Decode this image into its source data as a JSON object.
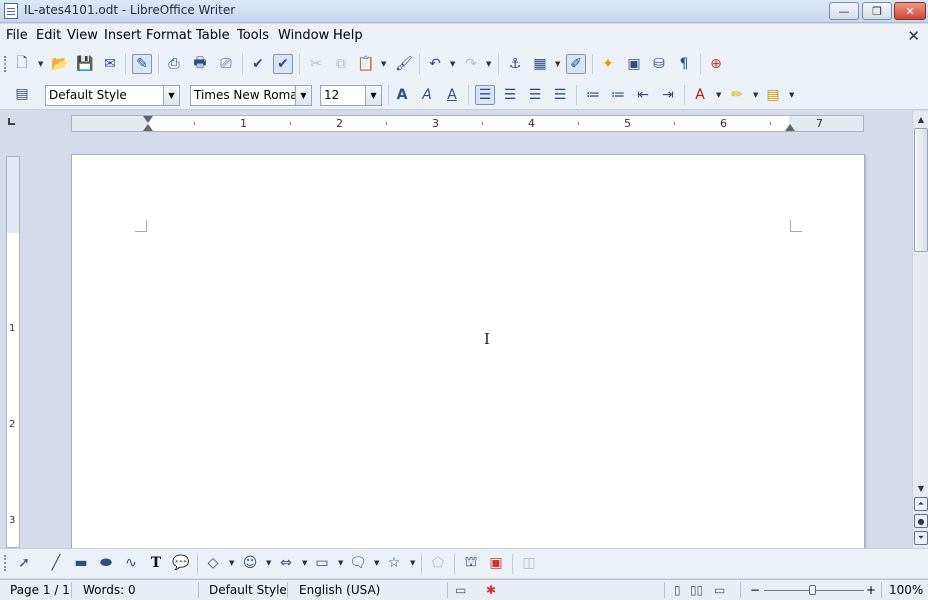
{
  "window": {
    "title": "IL-ates4101.odt - LibreOffice Writer",
    "minimize_label": "—",
    "maximize_label": "❐",
    "close_label": "✕"
  },
  "menu": {
    "items": [
      "File",
      "Edit",
      "View",
      "Insert",
      "Format",
      "Table",
      "Tools",
      "Window",
      "Help"
    ],
    "close_doc_label": "✕"
  },
  "formatting": {
    "paragraph_style": "Default Style",
    "font_name": "Times New Roman",
    "font_size": "12",
    "dropdown_arrow": "▼"
  },
  "ruler": {
    "labels": [
      "1",
      "2",
      "3",
      "4",
      "5",
      "6",
      "7"
    ],
    "vertical_labels": [
      "1",
      "2",
      "3"
    ]
  },
  "status": {
    "page": "Page 1 / 1",
    "words": "Words: 0",
    "page_style": "Default Style",
    "language": "English (USA)",
    "zoom": "100%",
    "zoom_out": "−",
    "zoom_in": "+"
  },
  "colors": {
    "accent": "#2f4f7e",
    "toolbar_bg": "#ecf0f7",
    "workspace_bg": "#d6dbe9",
    "close_button": "#c94a32"
  }
}
